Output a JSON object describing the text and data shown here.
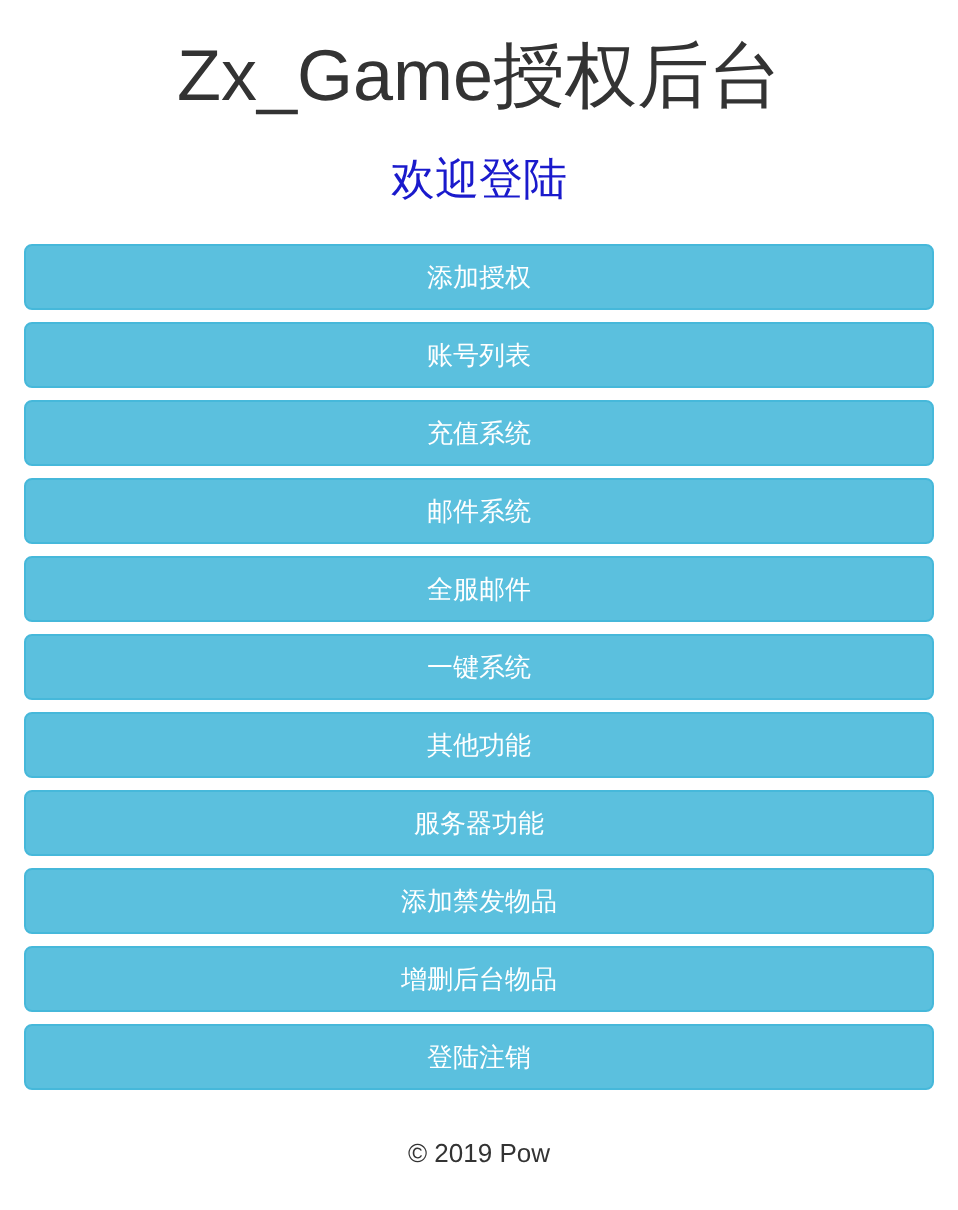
{
  "header": {
    "title": "Zx_Game授权后台",
    "subtitle": "欢迎登陆"
  },
  "menu": [
    {
      "label": "添加授权"
    },
    {
      "label": "账号列表"
    },
    {
      "label": "充值系统"
    },
    {
      "label": "邮件系统"
    },
    {
      "label": "全服邮件"
    },
    {
      "label": "一键系统"
    },
    {
      "label": "其他功能"
    },
    {
      "label": "服务器功能"
    },
    {
      "label": "添加禁发物品"
    },
    {
      "label": "增删后台物品"
    },
    {
      "label": "登陆注销"
    }
  ],
  "footer": "© 2019 Pow"
}
